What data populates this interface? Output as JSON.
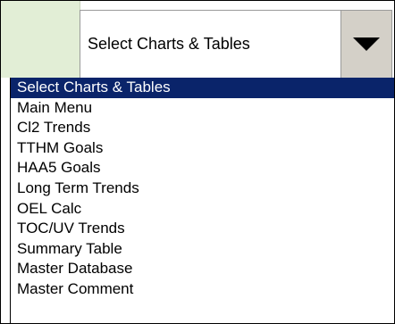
{
  "combo": {
    "selected_value": "Select Charts & Tables"
  },
  "dropdown": {
    "items": [
      {
        "label": "Select Charts & Tables"
      },
      {
        "label": "Main Menu"
      },
      {
        "label": "Cl2 Trends"
      },
      {
        "label": "TTHM Goals"
      },
      {
        "label": "HAA5 Goals"
      },
      {
        "label": "Long Term Trends"
      },
      {
        "label": "OEL Calc"
      },
      {
        "label": "TOC/UV Trends"
      },
      {
        "label": "Summary Table"
      },
      {
        "label": "Master Database"
      },
      {
        "label": "Master Comment"
      }
    ]
  },
  "icons": {
    "dropdown_arrow": "chevron-down-icon"
  },
  "colors": {
    "selection_highlight": "#0a246a",
    "green_cell": "#e2eed6",
    "button_face": "#d4d0c8"
  }
}
